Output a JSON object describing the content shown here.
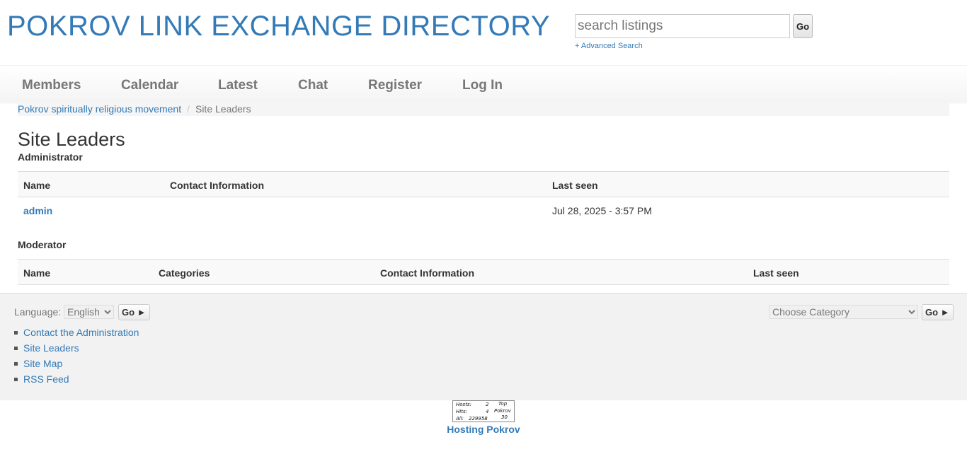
{
  "header": {
    "site_title": "POKROV LINK EXCHANGE DIRECTORY",
    "search_placeholder": "search listings",
    "search_button": "Go",
    "advanced_search": "+ Advanced Search"
  },
  "nav": {
    "items": [
      "Members",
      "Calendar",
      "Latest",
      "Chat",
      "Register",
      "Log In"
    ]
  },
  "breadcrumb": {
    "home": "Pokrov spiritually religious movement",
    "current": "Site Leaders"
  },
  "main": {
    "title": "Site Leaders",
    "administrator": {
      "heading": "Administrator",
      "columns": [
        "Name",
        "Contact Information",
        "Last seen"
      ],
      "rows": [
        {
          "name": "admin",
          "contact": "",
          "last_seen": "Jul 28, 2025 - 3:57 PM"
        }
      ]
    },
    "moderator": {
      "heading": "Moderator",
      "columns": [
        "Name",
        "Categories",
        "Contact Information",
        "Last seen"
      ],
      "rows": []
    }
  },
  "footer": {
    "language_label": "Language:",
    "language_value": "English",
    "language_go": "Go ►",
    "category_value": "Choose Category",
    "category_go": "Go ►",
    "links": [
      "Contact the Administration",
      "Site Leaders",
      "Site Map",
      "RSS Feed"
    ]
  },
  "counter": {
    "hosts_label": "Hosts:",
    "hosts_value": "2",
    "hits_label": "Hits:",
    "hits_value": "4",
    "all_label": "All:",
    "all_value": "229958",
    "top_label": "Top",
    "brand": "Pokrov",
    "rank": "30"
  },
  "hosting_link": "Hosting Pokrov"
}
